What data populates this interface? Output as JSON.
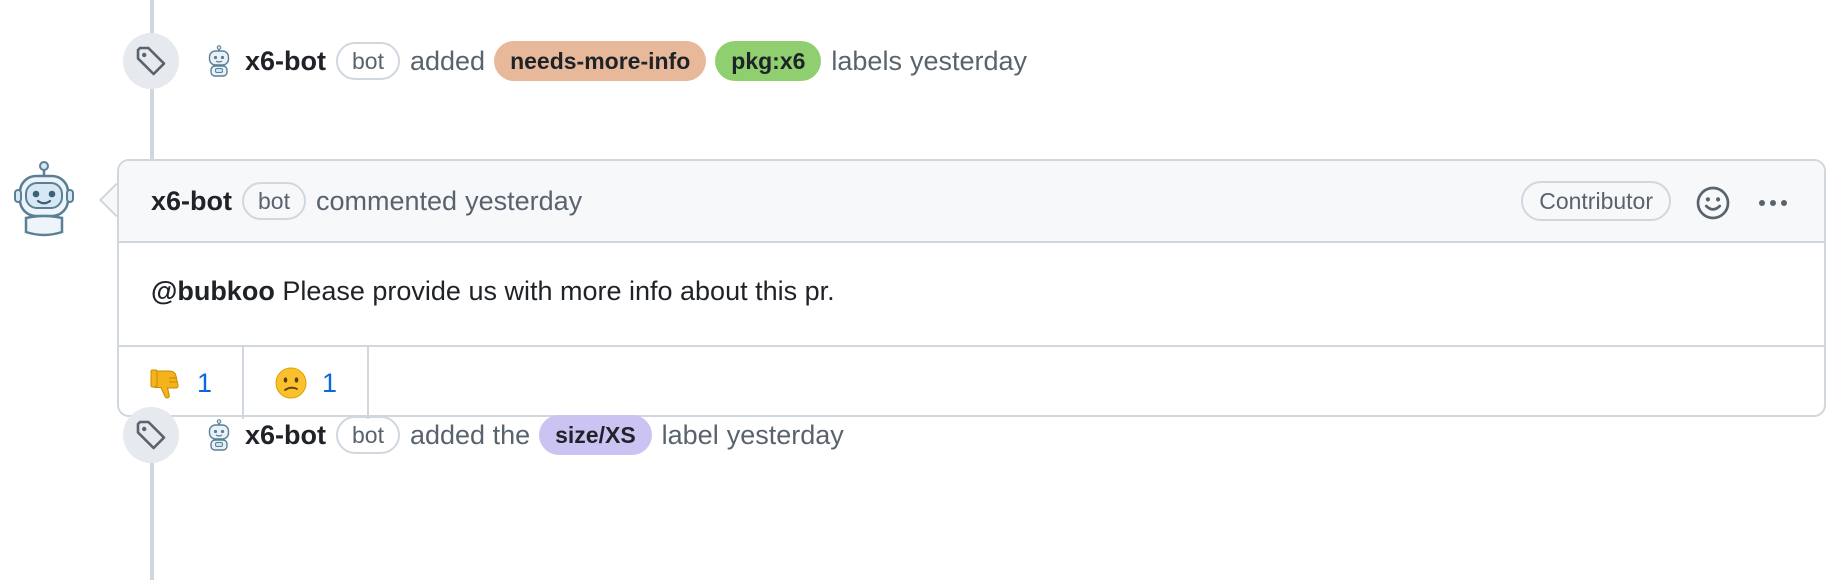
{
  "events": [
    {
      "author": "x6-bot",
      "badge": "bot",
      "verb": "added",
      "labels": [
        {
          "name": "needs-more-info",
          "color": "#e8b89a"
        },
        {
          "name": "pkg:x6",
          "color": "#8fcf6f"
        }
      ],
      "suffix": "labels",
      "time": "yesterday"
    },
    {
      "author": "x6-bot",
      "badge": "bot",
      "verb": "added the",
      "labels": [
        {
          "name": "size/XS",
          "color": "#cbc3f2"
        }
      ],
      "suffix": "label",
      "time": "yesterday"
    }
  ],
  "comment": {
    "author": "x6-bot",
    "badge": "bot",
    "action": "commented",
    "time": "yesterday",
    "role": "Contributor",
    "mention": "@bubkoo",
    "body": "Please provide us with more info about this pr.",
    "reactions": [
      {
        "emoji": "thumbs-down",
        "count": "1"
      },
      {
        "emoji": "confused-face",
        "count": "1"
      }
    ]
  },
  "icons": {
    "event": "tag-icon",
    "avatar": "robot-avatar",
    "add_reaction": "smiley-icon",
    "more": "kebab-horizontal-icon"
  },
  "colors": {
    "link": "#0969da",
    "border": "#d0d7de",
    "header_bg": "#f6f8fa"
  }
}
